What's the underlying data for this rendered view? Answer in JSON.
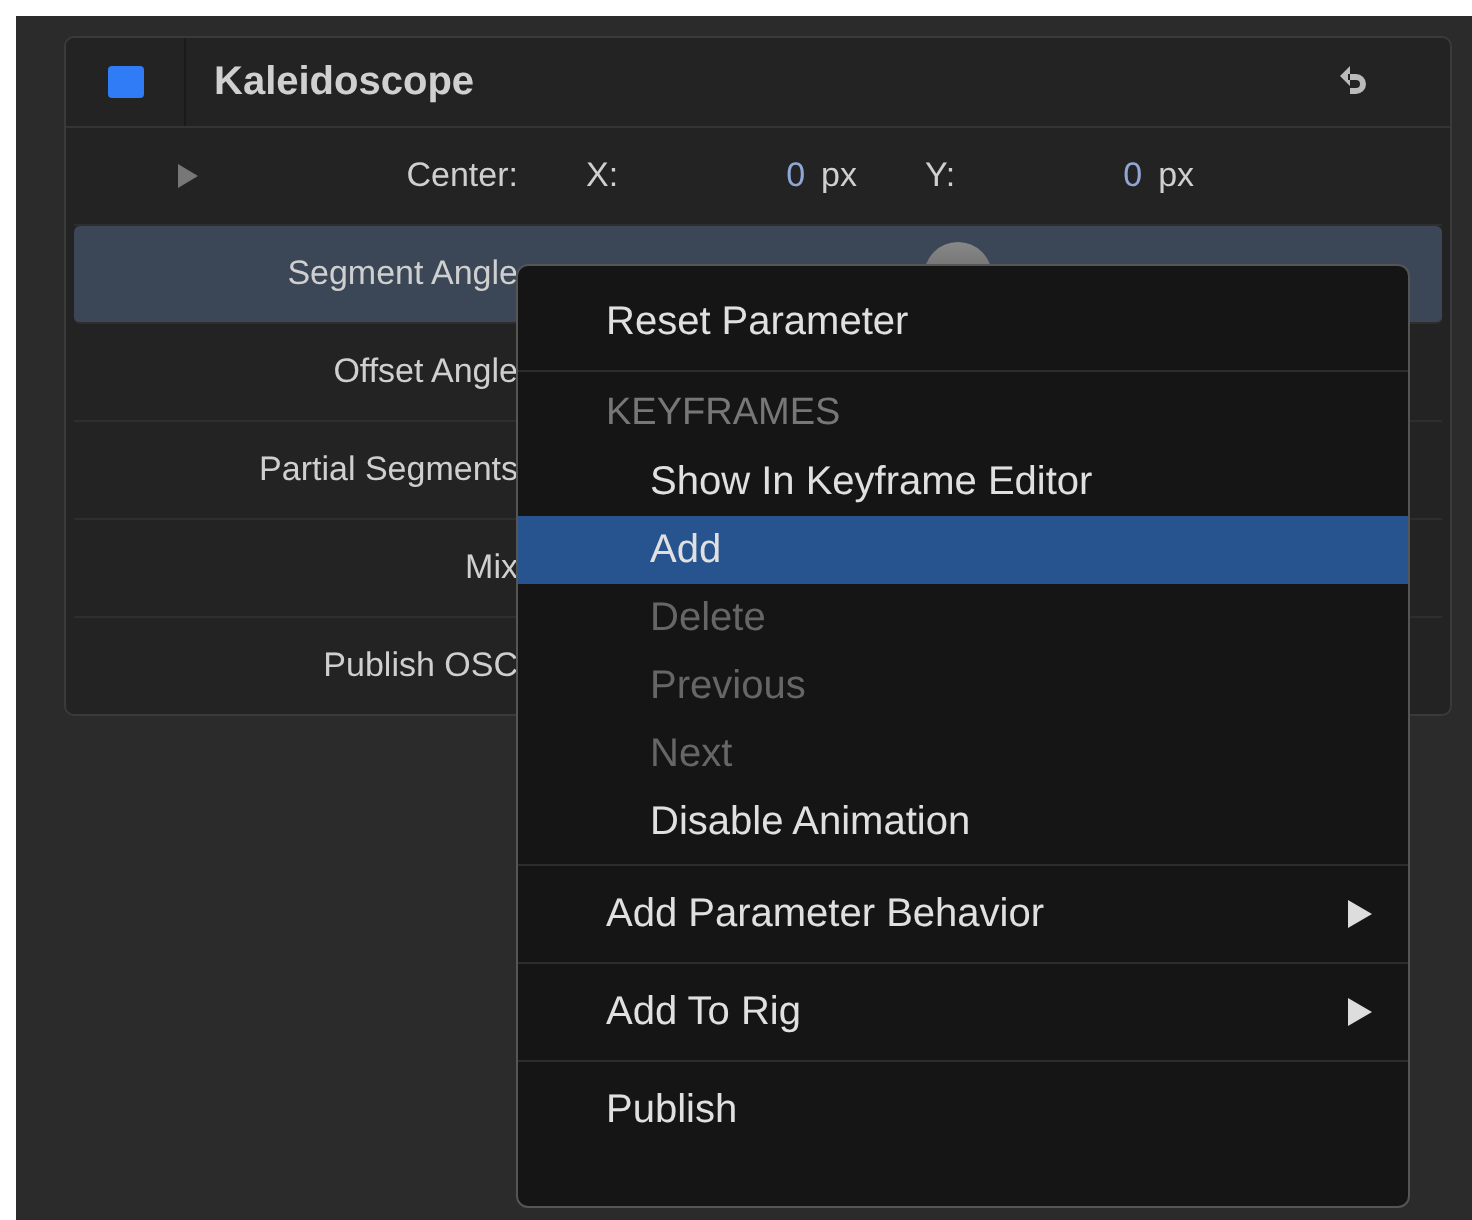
{
  "panel": {
    "title": "Kaleidoscope",
    "enabled": true,
    "rows": [
      {
        "kind": "point",
        "label": "Center:",
        "expanded": false,
        "x_label": "X:",
        "x_value": "0",
        "x_unit": "px",
        "y_label": "Y:",
        "y_value": "0",
        "y_unit": "px",
        "selected": false
      },
      {
        "kind": "slider",
        "label": "Segment Angle",
        "selected": true
      },
      {
        "kind": "plain",
        "label": "Offset Angle",
        "selected": false
      },
      {
        "kind": "plain",
        "label": "Partial Segments",
        "selected": false
      },
      {
        "kind": "plain",
        "label": "Mix",
        "selected": false
      },
      {
        "kind": "plain",
        "label": "Publish OSC",
        "selected": false
      }
    ]
  },
  "context_menu": {
    "groups": [
      {
        "items": [
          {
            "label": "Reset Parameter",
            "disabled": false,
            "selected": false,
            "submenu": false
          }
        ]
      },
      {
        "header": "KEYFRAMES",
        "items": [
          {
            "label": "Show In Keyframe Editor",
            "disabled": false,
            "selected": false,
            "submenu": false
          },
          {
            "label": "Add",
            "disabled": false,
            "selected": true,
            "submenu": false
          },
          {
            "label": "Delete",
            "disabled": true,
            "selected": false,
            "submenu": false
          },
          {
            "label": "Previous",
            "disabled": true,
            "selected": false,
            "submenu": false
          },
          {
            "label": "Next",
            "disabled": true,
            "selected": false,
            "submenu": false
          },
          {
            "label": "Disable Animation",
            "disabled": false,
            "selected": false,
            "submenu": false
          }
        ]
      },
      {
        "items": [
          {
            "label": "Add Parameter Behavior",
            "disabled": false,
            "selected": false,
            "submenu": true
          }
        ]
      },
      {
        "items": [
          {
            "label": "Add To Rig",
            "disabled": false,
            "selected": false,
            "submenu": true
          }
        ]
      },
      {
        "items": [
          {
            "label": "Publish",
            "disabled": false,
            "selected": false,
            "submenu": false
          }
        ]
      }
    ]
  }
}
